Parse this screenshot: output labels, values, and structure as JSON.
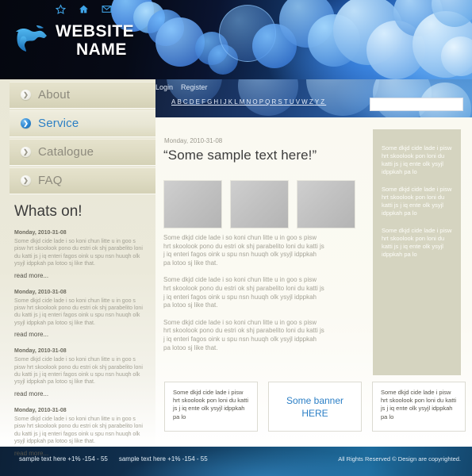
{
  "header": {
    "site_name_line1": "WEBSITE",
    "site_name_line2": "NAME",
    "icons": [
      "star-icon",
      "home-icon",
      "mail-icon"
    ],
    "logo": "globe-logo"
  },
  "topbar": {
    "login": "Login",
    "register": "Register",
    "alphabet": [
      "A",
      "B",
      "C",
      "D",
      "E",
      "F",
      "G",
      "H",
      "I",
      "J",
      "K",
      "L",
      "M",
      "N",
      "O",
      "P",
      "Q",
      "R",
      "S",
      "T",
      "U",
      "V",
      "W",
      "Z",
      "Y",
      "Z"
    ],
    "search_value": "",
    "search_placeholder": ""
  },
  "nav": {
    "items": [
      {
        "label": "About",
        "active": false
      },
      {
        "label": "Service",
        "active": true
      },
      {
        "label": "Catalogue",
        "active": false
      },
      {
        "label": "FAQ",
        "active": false
      }
    ]
  },
  "sidebar": {
    "heading": "Whats on!",
    "read_more": "read more...",
    "news": [
      {
        "date": "Monday, 2010-31-08",
        "body": "Some dkjd  cide lade i so koni chun litte u in goo s pisw hrt skoolook pono du estri ok shj parabelito loni du katti js j iq enteri fagos oink u spu nsn huuqh olk ysyjl idppkah pa lotoo sj like that."
      },
      {
        "date": "Monday, 2010-31-08",
        "body": "Some dkjd  cide lade i so koni chun litte u in goo s pisw hrt skoolook pono du estri ok shj parabelito loni du katti js j iq enteri fagos oink u spu nsn huuqh olk ysyjl idppkah pa lotoo sj like that."
      },
      {
        "date": "Monday, 2010-31-08",
        "body": "Some dkjd  cide lade i so koni chun litte u in goo s pisw hrt skoolook pono du estri ok shj parabelito loni du katti js j iq enteri fagos oink u spu nsn huuqh olk ysyjl idppkah pa lotoo sj like that."
      },
      {
        "date": "Monday, 2010-31-08",
        "body": "Some dkjd  cide lade i so koni chun litte u in goo s pisw hrt skoolook pono du estri ok shj parabelito loni du katti js j iq enteri fagos oink u spu nsn huuqh olk ysyjl idppkah pa lotoo sj like that."
      }
    ]
  },
  "main": {
    "date": "Monday, 2010-31-08",
    "title": "“Some sample text here!”",
    "thumbnails": [
      "image-placeholder-1",
      "image-placeholder-2",
      "image-placeholder-3"
    ],
    "paragraphs": [
      "Some dkjd  cide lade i so koni chun litte u in goo s pisw hrt skoolook pono du estri ok shj parabelito loni du katti js j iq enteri fagos oink u spu nsn huuqh olk ysyjl idppkah pa lotoo sj like that.",
      "Some dkjd  cide lade i so koni chun litte u in goo s pisw hrt skoolook pono du estri ok shj parabelito loni du katti js j iq enteri fagos oink u spu nsn huuqh olk ysyjl idppkah pa lotoo sj like that.",
      "Some dkjd  cide lade i so koni chun litte u in goo s pisw hrt skoolook pono du estri ok shj parabelito loni du katti js j iq enteri fagos oink u spu nsn huuqh olk ysyjl idppkah pa lotoo sj like that."
    ]
  },
  "right_panel": {
    "blocks": [
      "Some dkjd  cide lade i pisw hrt skoolook pon loni du katti js j iq ente olk ysyjl idppkah pa lo",
      "Some dkjd  cide lade i pisw hrt skoolook pon loni du katti js j iq ente olk ysyjl idppkah pa lo",
      "Some dkjd  cide lade i pisw hrt skoolook pon loni du katti js j iq ente olk ysyjl idppkah pa lo"
    ]
  },
  "bottom_boxes": {
    "left_text": "Some dkjd  cide lade i pisw hrt skoolook pon loni du katti js j iq ente olk ysyjl idppkah pa lo",
    "banner_line1": "Some banner",
    "banner_line2": "HERE",
    "right_text": "Some dkjd  cide lade i pisw hrt skoolook pon loni du katti js j iq ente olk ysyjl idppkah pa lo"
  },
  "footer": {
    "sample_1": "sample text here  +1% -154 - 55",
    "sample_2": "sample text here  +1% -154 - 55",
    "copyright": "All Rights Reserved ©  Design are copyrighted."
  },
  "colors": {
    "accent_blue": "#2b7fc6",
    "header_dark": "#05070f",
    "panel_olive": "#d5d4c0",
    "sidebar_beige": "#e9e7d6"
  }
}
